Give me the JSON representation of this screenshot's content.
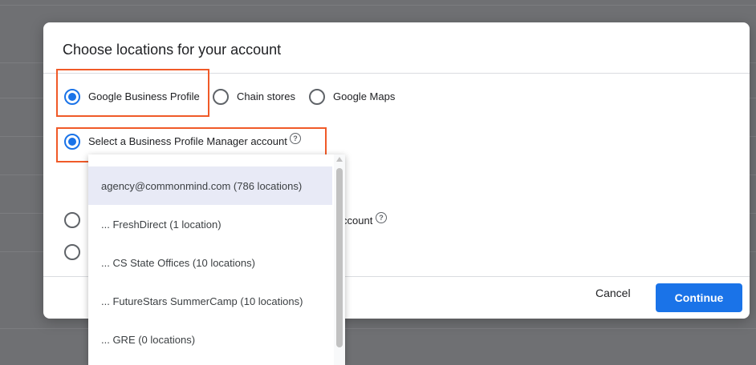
{
  "dialog": {
    "title": "Choose locations for your account",
    "source_options": [
      {
        "label": "Google Business Profile",
        "checked": true
      },
      {
        "label": "Chain stores",
        "checked": false
      },
      {
        "label": "Google Maps",
        "checked": false
      }
    ],
    "manager_option": {
      "label": "Select a Business Profile Manager account",
      "checked": true
    },
    "hidden_option_partial": "ccount",
    "cancel_label": "Cancel",
    "continue_label": "Continue"
  },
  "dropdown": {
    "items": [
      "agency@commonmind.com (786 locations)",
      "... FreshDirect (1 location)",
      "... CS State Offices (10 locations)",
      "... FutureStars SummerCamp (10 locations)",
      "... GRE (0 locations)"
    ],
    "selected_index": 0
  },
  "colors": {
    "accent": "#1a73e8",
    "highlight": "#f05a28",
    "selected_row": "#e8eaf6"
  }
}
